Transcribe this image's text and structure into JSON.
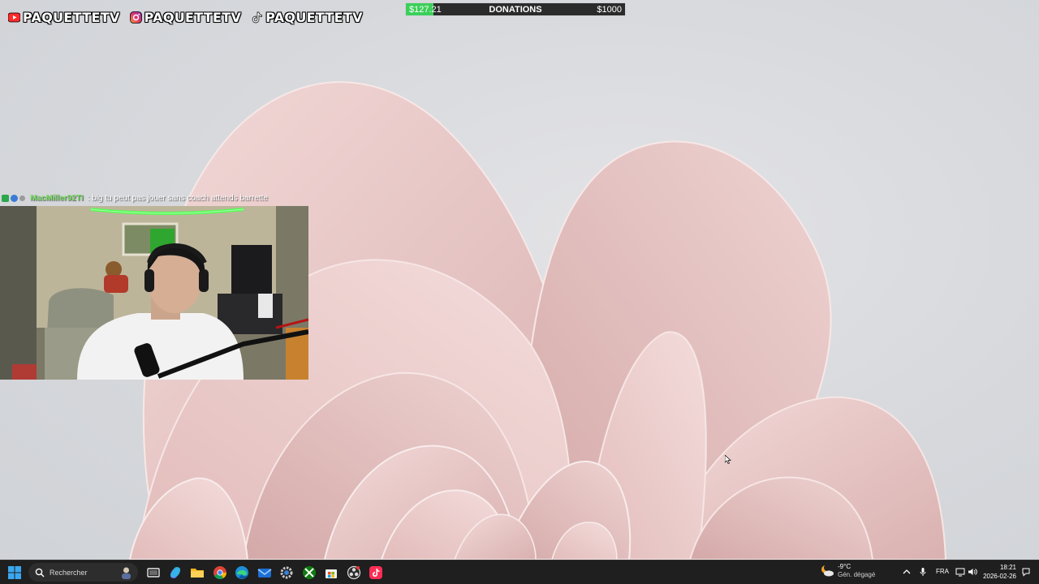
{
  "socials": [
    {
      "platform": "youtube",
      "icon": "youtube-icon",
      "handle": "PAQUETTETV"
    },
    {
      "platform": "instagram",
      "icon": "instagram-icon",
      "handle": "PAQUETTETV"
    },
    {
      "platform": "tiktok",
      "icon": "tiktok-icon",
      "handle": "PAQUETTETV"
    }
  ],
  "donation": {
    "current": "$127.21",
    "title": "DONATIONS",
    "goal": "$1000",
    "progress": 0.127,
    "fill_color": "#3ccf5a"
  },
  "chat": {
    "badges": [
      "green-badge-icon",
      "blue-badge-icon",
      "gray-badge-icon"
    ],
    "username": "MacMiller92TI",
    "message": ": big tu peut pas jouer sans coach attends barrette",
    "username_color": "#7ee06a"
  },
  "webcam": {
    "icon": "webcam-feed-icon"
  },
  "taskbar": {
    "search_placeholder": "Rechercher",
    "pinned_apps": [
      "task-view-icon",
      "copilot-icon",
      "file-explorer-icon",
      "chrome-icon",
      "edge-icon",
      "mail-icon",
      "settings-icon",
      "xbox-icon",
      "store-icon",
      "obs-icon",
      "tiktok-live-icon"
    ],
    "weather": {
      "temp": "-9°C",
      "condition": "Gén. dégagé"
    },
    "language": "FRA",
    "time": "18:21",
    "date": "2026-02-26"
  },
  "colors": {
    "taskbar_bg": "#1f1f1f",
    "wallpaper_petal": "#e8c8c8",
    "accent_green": "#3ccf5a"
  }
}
